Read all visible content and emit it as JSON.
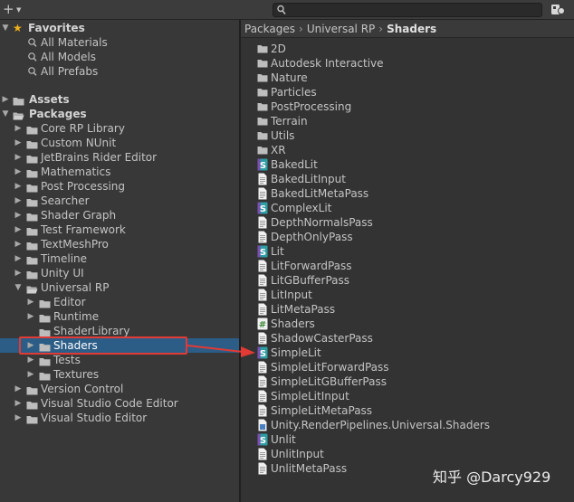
{
  "toolbar": {
    "add_icon": "plus-icon",
    "search_placeholder": ""
  },
  "tree": {
    "favorites_label": "Favorites",
    "favorites": [
      "All Materials",
      "All Models",
      "All Prefabs"
    ],
    "assets_label": "Assets",
    "packages_label": "Packages",
    "packages": [
      "Core RP Library",
      "Custom NUnit",
      "JetBrains Rider Editor",
      "Mathematics",
      "Post Processing",
      "Searcher",
      "Shader Graph",
      "Test Framework",
      "TextMeshPro",
      "Timeline",
      "Unity UI",
      "Universal RP"
    ],
    "urp_children": [
      "Editor",
      "Runtime",
      "ShaderLibrary",
      "Shaders",
      "Tests",
      "Textures"
    ],
    "packages_after": [
      "Version Control",
      "Visual Studio Code Editor",
      "Visual Studio Editor"
    ]
  },
  "breadcrumb": [
    "Packages",
    "Universal RP",
    "Shaders"
  ],
  "items": [
    {
      "name": "2D",
      "kind": "folder"
    },
    {
      "name": "Autodesk Interactive",
      "kind": "folder"
    },
    {
      "name": "Nature",
      "kind": "folder"
    },
    {
      "name": "Particles",
      "kind": "folder"
    },
    {
      "name": "PostProcessing",
      "kind": "folder"
    },
    {
      "name": "Terrain",
      "kind": "folder"
    },
    {
      "name": "Utils",
      "kind": "folder"
    },
    {
      "name": "XR",
      "kind": "folder"
    },
    {
      "name": "BakedLit",
      "kind": "shader"
    },
    {
      "name": "BakedLitInput",
      "kind": "file"
    },
    {
      "name": "BakedLitMetaPass",
      "kind": "file"
    },
    {
      "name": "ComplexLit",
      "kind": "shader"
    },
    {
      "name": "DepthNormalsPass",
      "kind": "file"
    },
    {
      "name": "DepthOnlyPass",
      "kind": "file"
    },
    {
      "name": "Lit",
      "kind": "shader"
    },
    {
      "name": "LitForwardPass",
      "kind": "file"
    },
    {
      "name": "LitGBufferPass",
      "kind": "file"
    },
    {
      "name": "LitInput",
      "kind": "file"
    },
    {
      "name": "LitMetaPass",
      "kind": "file"
    },
    {
      "name": "Shaders",
      "kind": "csharp"
    },
    {
      "name": "ShadowCasterPass",
      "kind": "file"
    },
    {
      "name": "SimpleLit",
      "kind": "shader"
    },
    {
      "name": "SimpleLitForwardPass",
      "kind": "file"
    },
    {
      "name": "SimpleLitGBufferPass",
      "kind": "file"
    },
    {
      "name": "SimpleLitInput",
      "kind": "file"
    },
    {
      "name": "SimpleLitMetaPass",
      "kind": "file"
    },
    {
      "name": "Unity.RenderPipelines.Universal.Shaders",
      "kind": "asmdef"
    },
    {
      "name": "Unlit",
      "kind": "shader"
    },
    {
      "name": "UnlitInput",
      "kind": "file"
    },
    {
      "name": "UnlitMetaPass",
      "kind": "file"
    }
  ],
  "annotation": {
    "color": "#e23a34"
  },
  "watermark": "知乎 @Darcy929"
}
